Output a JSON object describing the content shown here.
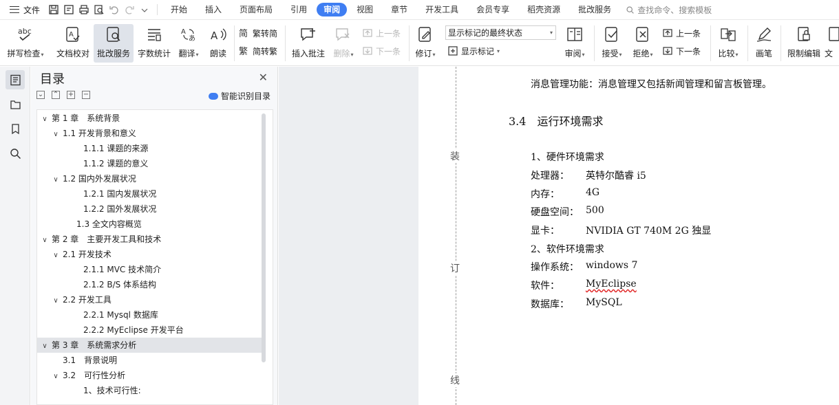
{
  "menubar": {
    "file_label": "文件",
    "tabs": [
      "开始",
      "插入",
      "页面布局",
      "引用",
      "审阅",
      "视图",
      "章节",
      "开发工具",
      "会员专享",
      "稻壳资源",
      "批改服务"
    ],
    "active_tab": "审阅",
    "search_placeholder": "查找命令、搜索模板"
  },
  "ribbon": {
    "spell_check": "拼写检查",
    "doc_proof": "文档校对",
    "correction_service": "批改服务",
    "word_count": "字数统计",
    "translate": "翻译",
    "read_aloud": "朗读",
    "trad_to_simp": "繁转简",
    "simp_to_trad": "简转繁",
    "insert_comment": "插入批注",
    "delete": "删除",
    "prev_item": "上一条",
    "next_item": "下一条",
    "track_changes": "修订",
    "markup_state": "显示标记的最终状态",
    "show_markup": "显示标记",
    "review": "审阅",
    "accept": "接受",
    "reject": "拒绝",
    "prev_change": "上一条",
    "next_change": "下一条",
    "compare": "比较",
    "pen": "画笔",
    "restrict_edit": "限制编辑",
    "doc_partial": "文"
  },
  "toc": {
    "title": "目录",
    "smart_label": "智能识别目录",
    "items": [
      {
        "text": "第 1 章　系统背景",
        "level": 0,
        "arrow": "v"
      },
      {
        "text": "1.1 开发背景和意义",
        "level": 1,
        "arrow": "v"
      },
      {
        "text": "1.1.1  课题的来源",
        "level": 2,
        "arrow": ""
      },
      {
        "text": "1.1.2 课题的意义",
        "level": 2,
        "arrow": ""
      },
      {
        "text": "1.2  国内外发展状况",
        "level": 1,
        "arrow": "v"
      },
      {
        "text": "1.2.1  国内发展状况",
        "level": 2,
        "arrow": ""
      },
      {
        "text": "1.2.2  国外发展状况",
        "level": 2,
        "arrow": ""
      },
      {
        "text": "1.3  全文内容概览",
        "level": 1.5,
        "arrow": ""
      },
      {
        "text": "第 2 章　主要开发工具和技术",
        "level": 0,
        "arrow": "v"
      },
      {
        "text": "2.1  开发技术",
        "level": 1,
        "arrow": "v"
      },
      {
        "text": "2.1.1 MVC 技术简介",
        "level": 2,
        "arrow": ""
      },
      {
        "text": "2.1.2 B/S 体系结构",
        "level": 2,
        "arrow": ""
      },
      {
        "text": "2.2  开发工具",
        "level": 1,
        "arrow": "v"
      },
      {
        "text": "2.2.1 Mysql 数据库",
        "level": 2,
        "arrow": ""
      },
      {
        "text": "2.2.2 MyEclipse 开发平台",
        "level": 2,
        "arrow": ""
      },
      {
        "text": "第 3 章　系统需求分析",
        "level": 0,
        "arrow": "v",
        "selected": true
      },
      {
        "text": "3.1　背景说明",
        "level": 1,
        "arrow": ""
      },
      {
        "text": "3.2　可行性分析",
        "level": 1,
        "arrow": "v"
      },
      {
        "text": "1、技术可行性:",
        "level": 2,
        "arrow": ""
      }
    ]
  },
  "document": {
    "gutter": [
      "装",
      "订",
      "线"
    ],
    "lines": [
      "消息管理功能：消息管理又包括新闻管理和留言板管理。",
      "3.4　运行环境需求",
      "1、硬件环境需求",
      "2、软件环境需求"
    ],
    "specs": [
      {
        "label": "处理器：",
        "value": "英特尔酷睿 i5"
      },
      {
        "label": "内存：",
        "value": "4G"
      },
      {
        "label": "硬盘空间：",
        "value": "500"
      },
      {
        "label": "显卡：",
        "value": "NVIDIA GT 740M 2G 独显"
      },
      {
        "label": "操作系统：",
        "value": "windows 7"
      },
      {
        "label": "软件：",
        "value": "MyEclipse"
      },
      {
        "label": "数据库：",
        "value": "MySQL"
      }
    ]
  },
  "colors": {
    "accent": "#3f7ef2",
    "spell_error": "#e02020"
  }
}
